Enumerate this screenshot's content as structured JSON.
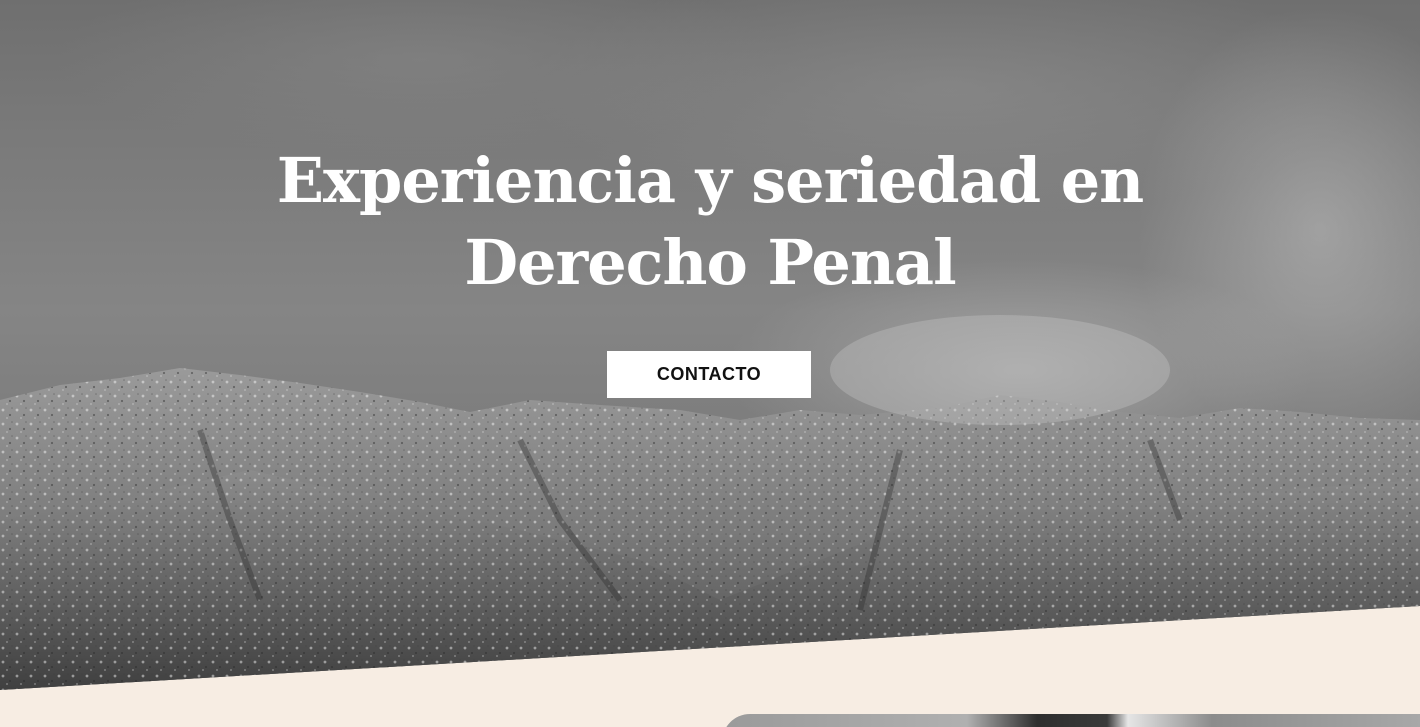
{
  "hero": {
    "title_line1": "Experiencia y seriedad en",
    "title_line2": "Derecho Penal",
    "cta_label": "CONTACTO"
  },
  "colors": {
    "section_background": "#f7ede3",
    "button_background": "#ffffff",
    "button_text": "#111111",
    "title_text": "#ffffff"
  }
}
